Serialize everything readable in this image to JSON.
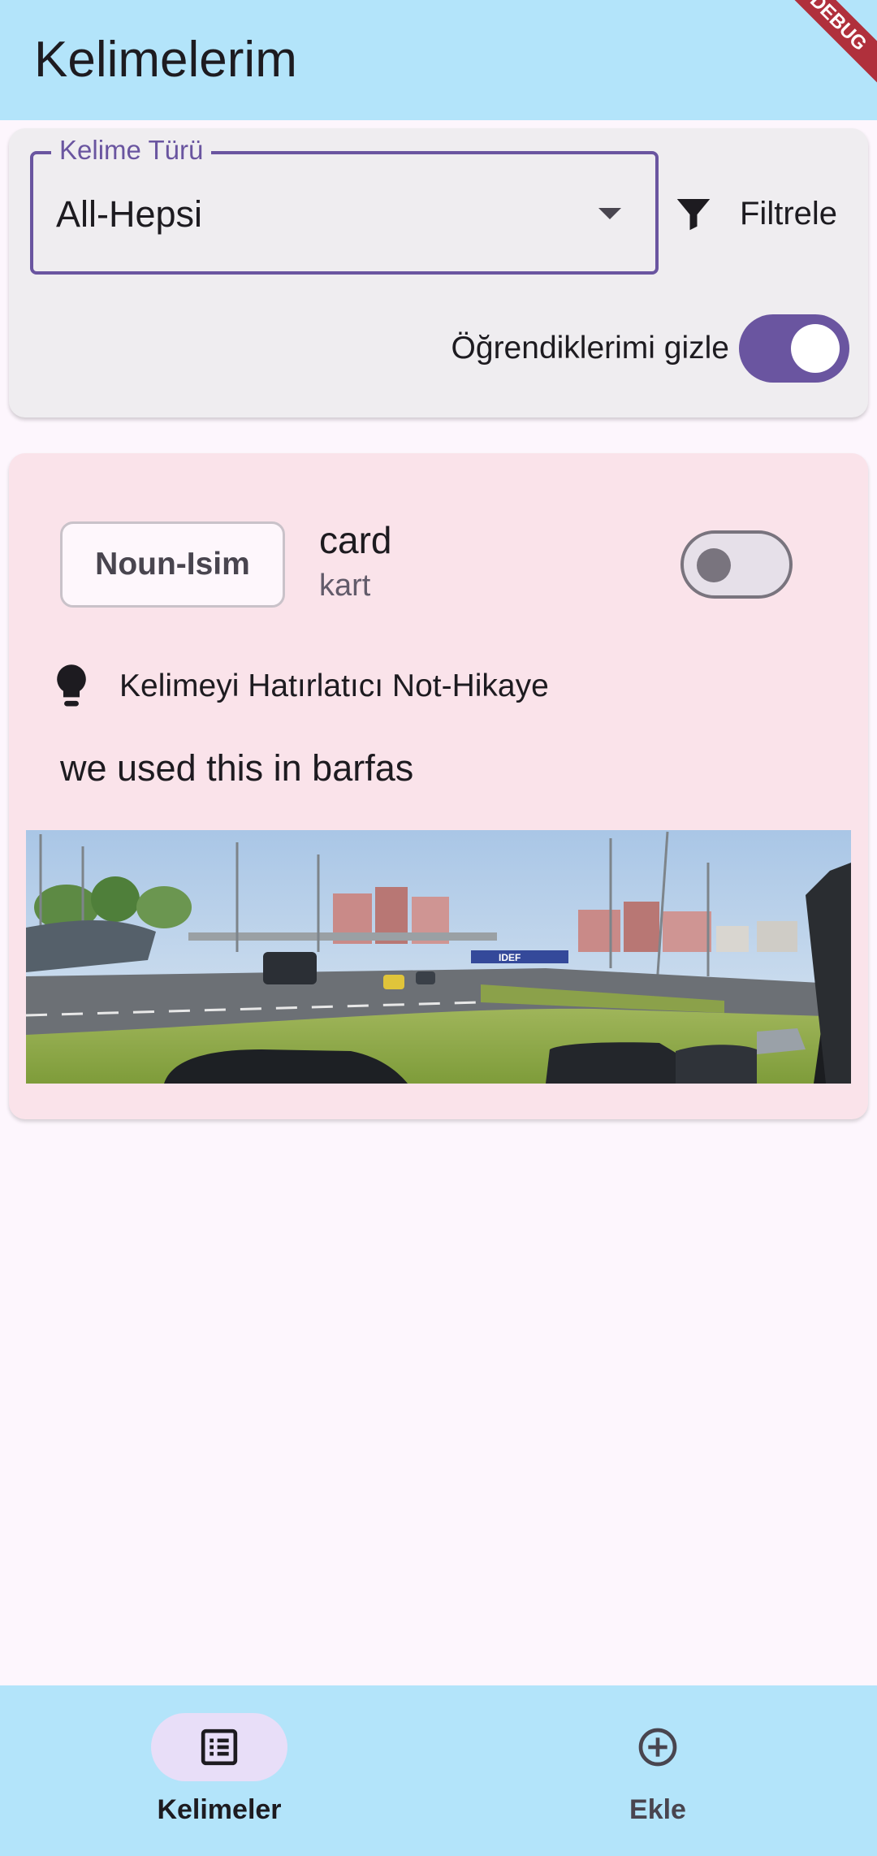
{
  "app_bar": {
    "title": "Kelimelerim",
    "debug_banner": "DEBUG"
  },
  "filter": {
    "dropdown_label": "Kelime Türü",
    "dropdown_value": "All-Hepsi",
    "filter_button_label": "Filtrele",
    "filter_icon": "filter-icon",
    "hide_learned_label": "Öğrendiklerimi gizle",
    "hide_learned_on": true
  },
  "word_card": {
    "type_chip": "Noun-Isim",
    "word": "card",
    "meaning": "kart",
    "learned_on": false,
    "hint_icon": "lightbulb-icon",
    "hint_label": "Kelimeyi Hatırlatıcı Not-Hikaye",
    "note": "we used this in barfas",
    "photo_sign_text": "IDEF"
  },
  "bottom_nav": {
    "items": [
      {
        "label": "Kelimeler",
        "icon": "list-icon",
        "active": true
      },
      {
        "label": "Ekle",
        "icon": "add-circle-icon",
        "active": false
      }
    ]
  },
  "colors": {
    "app_bar": "#b3e4fa",
    "accent": "#6a55a0",
    "card": "#fae3ea",
    "filter_card": "#efedf0",
    "background": "#fdf6fd",
    "nav_indicator": "#e8def8"
  }
}
